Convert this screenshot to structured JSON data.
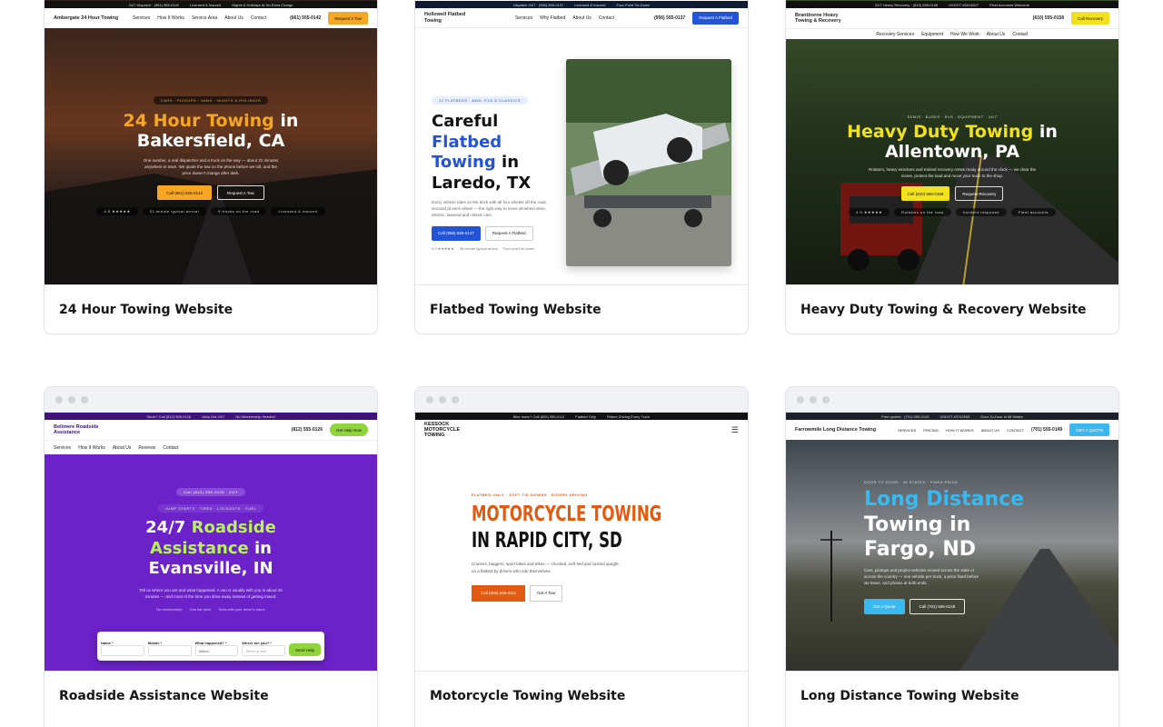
{
  "cards": [
    {
      "caption": "24 Hour Towing Website",
      "topbar": [
        "24/7 Dispatch · (661) 555-0142",
        "Licensed & Insured",
        "Nights & Holidays At No Extra Charge"
      ],
      "logo": "Ambergate 24 Hour Towing",
      "nav": [
        "Services",
        "How It Works",
        "Service Area",
        "About Us",
        "Contact"
      ],
      "phone": "(661) 555-0142",
      "cta": "Request A Tow",
      "pill": "CARS · PICKUPS · VANS · NIGHTS & HOLIDAYS",
      "headline_accent": "24 Hour Towing",
      "headline_rest": "in",
      "headline_city": "Bakersfield, CA",
      "body": "One number, a real dispatcher and a truck on the way — about 31 minutes anywhere in town. We quote the tow on the phone before we roll, and the price doesn't change after dark.",
      "btn_primary": "Call (661) 555-0142",
      "btn_secondary": "Request A Tow",
      "badges": [
        "4.8 ★★★★★",
        "31 minute typical arrival",
        "9 trucks on the road",
        "Licensed & insured"
      ]
    },
    {
      "caption": "Flatbed Towing Website",
      "topbar": [
        "Dispatch 24/7 · (956) 555-0137",
        "Licensed & Insured",
        "Four-Point Tie-Down"
      ],
      "logo": "Hollowell Flatbed Towing",
      "nav": [
        "Services",
        "Why Flatbed",
        "About Us",
        "Contact"
      ],
      "phone": "(956) 555-0137",
      "cta": "Request A Flatbed",
      "pill": "12 FLATBEDS · AWD, EVS & CLASSICS",
      "headline_1": "Careful",
      "headline_accent_1": "Flatbed",
      "headline_accent_2": "Towing",
      "headline_2": "in",
      "headline_city": "Laredo, TX",
      "body": "Every vehicle rides on the deck with all four wheels off the road, secured at each wheel — the right way to move all-wheel drive, electric, lowered and classic cars.",
      "btn_primary": "Call (956) 555-0137",
      "btn_secondary": "Request A Flatbed",
      "rating": "4.9 ★★★★★",
      "stat_1": "38 minute typical arrival",
      "stat_2": "Four-point tie-down"
    },
    {
      "caption": "Heavy Duty Towing & Recovery Website",
      "topbar": [
        "24/7 Heavy Recovery · (610) 555-0158",
        "USDOT #3514627",
        "Fleet Accounts Welcome"
      ],
      "logo": "Brantborne Heavy Towing & Recovery",
      "nav": [
        "Recovery Services",
        "Equipment",
        "How We Work",
        "About Us",
        "Contact"
      ],
      "phone": "(610) 555-0158",
      "cta": "Call Recovery",
      "pill": "SEMIS · BUSES · RVS · EQUIPMENT · 24/7",
      "headline_accent": "Heavy Duty Towing",
      "headline_rest": "in",
      "headline_city": "Allentown, PA",
      "body": "Rotators, heavy wreckers and trained recovery crews ready around the clock — we clear the scene, protect the load and move your truck to the shop.",
      "btn_primary": "Call (610) 555-0158",
      "btn_secondary": "Request Recovery",
      "badges": [
        "4.9 ★★★★★",
        "Rotators on the road",
        "Incident response",
        "Fleet accounts"
      ]
    },
    {
      "caption": "Roadside Assistance Website",
      "topbar": [
        "Stuck? Call (812) 555-0126",
        "Vans Out 24/7",
        "No Membership Needed"
      ],
      "logo": "Bellmere Roadside Assistance",
      "nav": [
        "Services",
        "How It Works",
        "About Us",
        "Reviews",
        "Contact"
      ],
      "phone": "(812) 555-0126",
      "cta": "Get Help Now",
      "pill_1": "Call (812) 555-0126 · 24/7",
      "pill_2": "JUMP STARTS · TIRES · LOCKOUTS · FUEL",
      "headline_1": "24/7",
      "headline_accent_1": "Roadside",
      "headline_accent_2": "Assistance",
      "headline_2": "in",
      "headline_city": "Evansville, IN",
      "body": "Tell us where you are and what happened. A van is usually with you in about 26 minutes — and most of the time you drive away instead of getting towed.",
      "stats": [
        "No membership",
        "One flat price",
        "Texts with your driver's name"
      ],
      "form": {
        "name_label": "Name *",
        "mobile_label": "Mobile *",
        "what_label": "What happened? *",
        "what_value": "Select...",
        "where_label": "Where are you? *",
        "where_placeholder": "Street or exit",
        "submit": "Send Help"
      }
    },
    {
      "caption": "Motorcycle Towing Website",
      "topbar": [
        "Bike down? Call (605) 555-0111",
        "Flatbed Only",
        "Riders Driving Every Truck"
      ],
      "logo": "KESSOCK MOTORCYCLE TOWING",
      "pill": "FLATBED ONLY · SOFT TIE-DOWNS · RIDERS DRIVING",
      "headline_1": "MOTORCYCLE TOWING",
      "headline_2": "IN RAPID CITY, SD",
      "body": "Cruisers, baggers, sport bikes and trikes — chocked, soft-tied and carried upright on a flatbed by drivers who ride themselves.",
      "btn_primary": "Call (605) 555-0111",
      "btn_secondary": "Get A Tow"
    },
    {
      "caption": "Long Distance Towing Website",
      "topbar": [
        "Free quotes · (701) 555-0149",
        "USDOT #3742553",
        "Door-To-Door In All States"
      ],
      "logo": "Farrowmile Long Distance Towing",
      "nav": [
        "SERVICES",
        "PRICING",
        "HOW IT WORKS",
        "ABOUT US",
        "CONTACT"
      ],
      "phone": "(701) 555-0149",
      "cta": "GET A QUOTE",
      "pill": "DOOR TO DOOR · 48 STATES · FIXED PRICE",
      "headline_accent": "Long Distance",
      "headline_1": "Towing in",
      "headline_city": "Fargo, ND",
      "body": "Cars, pickups and project vehicles moved across the state or across the country — one vehicle per truck, a price fixed before we leave, and photos at both ends.",
      "btn_primary": "Get A Quote",
      "btn_secondary": "Call (701) 555-0149"
    }
  ],
  "colors": {
    "orange": "#f5a623",
    "blue": "#2454d6",
    "yellow": "#f2e21d",
    "purple": "#6b22c8",
    "lime": "#8fd43a",
    "moto_orange": "#e05a12",
    "sky": "#3ab8f0"
  }
}
